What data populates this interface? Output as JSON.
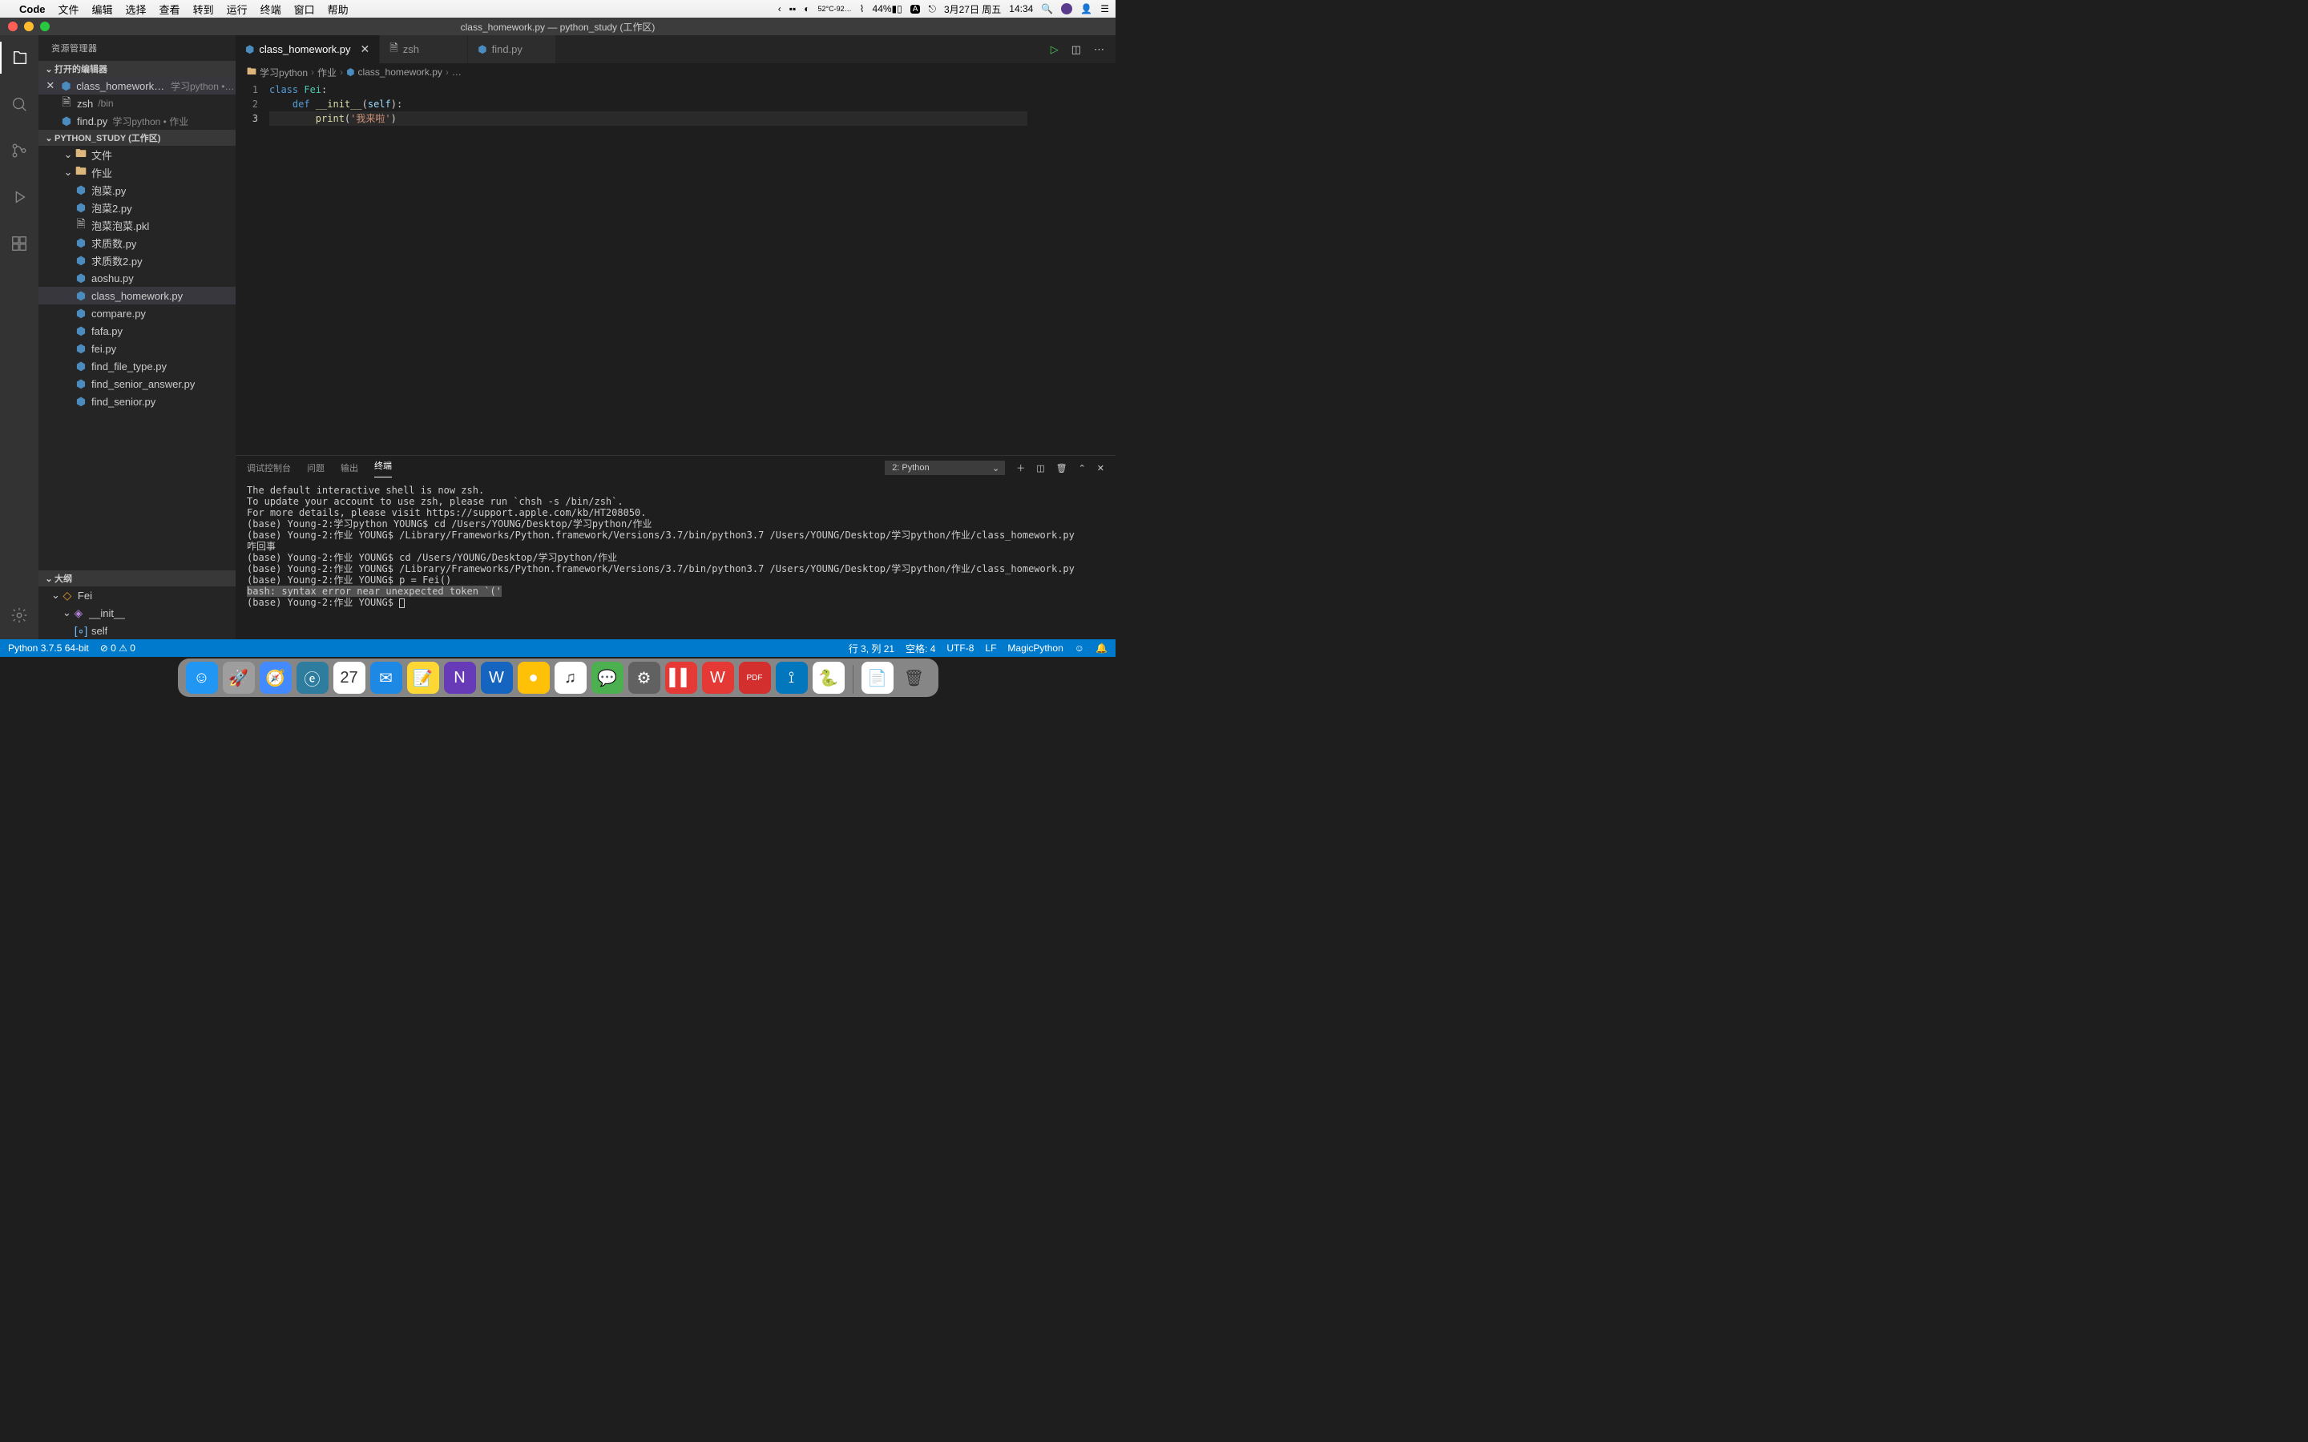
{
  "macos": {
    "appname": "Code",
    "menus": [
      "文件",
      "编辑",
      "选择",
      "查看",
      "转到",
      "运行",
      "终端",
      "窗口",
      "帮助"
    ],
    "temp": "52°C",
    "temp2": "-92…",
    "battery": "44%",
    "date": "3月27日 周五",
    "time": "14:34"
  },
  "window": {
    "title": "class_homework.py — python_study (工作区)"
  },
  "sidebar": {
    "title": "资源管理器",
    "openEditors": {
      "header": "打开的编辑器",
      "items": [
        {
          "name": "class_homework.py",
          "path": "学习python • …",
          "icon": "py",
          "active": true,
          "showClose": true
        },
        {
          "name": "zsh",
          "path": "/bin",
          "icon": "file",
          "active": false,
          "showClose": false
        },
        {
          "name": "find.py",
          "path": "学习python • 作业",
          "icon": "py",
          "active": false,
          "showClose": false
        }
      ]
    },
    "workspace": {
      "header": "PYTHON_STUDY (工作区)",
      "tree": [
        {
          "type": "folder",
          "name": "文件",
          "depth": 1,
          "expanded": true,
          "chev": "⌄"
        },
        {
          "type": "folder",
          "name": "作业",
          "depth": 1,
          "expanded": true,
          "chev": "⌄"
        },
        {
          "type": "py",
          "name": "泡菜.py",
          "depth": 2
        },
        {
          "type": "py",
          "name": "泡菜2.py",
          "depth": 2
        },
        {
          "type": "file",
          "name": "泡菜泡菜.pkl",
          "depth": 2
        },
        {
          "type": "py",
          "name": "求质数.py",
          "depth": 2
        },
        {
          "type": "py",
          "name": "求质数2.py",
          "depth": 2
        },
        {
          "type": "py",
          "name": "aoshu.py",
          "depth": 2
        },
        {
          "type": "py",
          "name": "class_homework.py",
          "depth": 2,
          "selected": true
        },
        {
          "type": "py",
          "name": "compare.py",
          "depth": 2
        },
        {
          "type": "py",
          "name": "fafa.py",
          "depth": 2
        },
        {
          "type": "py",
          "name": "fei.py",
          "depth": 2
        },
        {
          "type": "py",
          "name": "find_file_type.py",
          "depth": 2
        },
        {
          "type": "py",
          "name": "find_senior_answer.py",
          "depth": 2
        },
        {
          "type": "py",
          "name": "find_senior.py",
          "depth": 2
        }
      ]
    },
    "outline": {
      "header": "大纲",
      "items": [
        {
          "kind": "class",
          "name": "Fei",
          "depth": 0
        },
        {
          "kind": "method",
          "name": "__init__",
          "depth": 1
        },
        {
          "kind": "var",
          "name": "self",
          "depth": 2
        }
      ]
    }
  },
  "tabs": [
    {
      "name": "class_homework.py",
      "icon": "py",
      "active": true,
      "close": true
    },
    {
      "name": "zsh",
      "icon": "file",
      "active": false,
      "close": false
    },
    {
      "name": "find.py",
      "icon": "py",
      "active": false,
      "close": false
    }
  ],
  "breadcrumbs": [
    "学习python",
    "作业",
    "class_homework.py",
    "…"
  ],
  "code": {
    "lines": [
      "1",
      "2",
      "3"
    ],
    "currentLine": 3
  },
  "panel": {
    "tabs": [
      "调试控制台",
      "问题",
      "输出",
      "终端"
    ],
    "activeTab": "终端",
    "selector": "2: Python",
    "terminal_lines": [
      "The default interactive shell is now zsh.",
      "To update your account to use zsh, please run `chsh -s /bin/zsh`.",
      "For more details, please visit https://support.apple.com/kb/HT208050.",
      "(base) Young-2:学习python YOUNG$ cd /Users/YOUNG/Desktop/学习python/作业",
      "(base) Young-2:作业 YOUNG$ /Library/Frameworks/Python.framework/Versions/3.7/bin/python3.7 /Users/YOUNG/Desktop/学习python/作业/class_homework.py",
      "咋回事",
      "(base) Young-2:作业 YOUNG$ cd /Users/YOUNG/Desktop/学习python/作业",
      "(base) Young-2:作业 YOUNG$ /Library/Frameworks/Python.framework/Versions/3.7/bin/python3.7 /Users/YOUNG/Desktop/学习python/作业/class_homework.py",
      "(base) Young-2:作业 YOUNG$ p = Fei()"
    ],
    "terminal_error": "bash: syntax error near unexpected token `('",
    "terminal_prompt": "(base) Young-2:作业 YOUNG$ "
  },
  "statusbar": {
    "python": "Python 3.7.5 64-bit",
    "errors": "0",
    "warnings": "0",
    "lineCol": "行 3, 列 21",
    "spaces": "空格: 4",
    "encoding": "UTF-8",
    "eol": "LF",
    "lang": "MagicPython"
  },
  "dock": {
    "items": [
      {
        "name": "finder",
        "bg": "#2196f3",
        "glyph": "☺"
      },
      {
        "name": "launchpad",
        "bg": "#9e9e9e",
        "glyph": "🚀"
      },
      {
        "name": "safari",
        "bg": "#448aff",
        "glyph": "🧭"
      },
      {
        "name": "edge",
        "bg": "#2e7d9e",
        "glyph": "ⓔ"
      },
      {
        "name": "calendar",
        "bg": "#ffffff",
        "glyph": "27"
      },
      {
        "name": "outlook",
        "bg": "#1e88e5",
        "glyph": "✉"
      },
      {
        "name": "notes",
        "bg": "#fdd835",
        "glyph": "📝"
      },
      {
        "name": "onenote",
        "bg": "#673ab7",
        "glyph": "N"
      },
      {
        "name": "word",
        "bg": "#1565c0",
        "glyph": "W"
      },
      {
        "name": "app1",
        "bg": "#ffc107",
        "glyph": "●"
      },
      {
        "name": "music",
        "bg": "#ffffff",
        "glyph": "♫"
      },
      {
        "name": "wechat",
        "bg": "#4caf50",
        "glyph": "💬"
      },
      {
        "name": "settings",
        "bg": "#616161",
        "glyph": "⚙"
      },
      {
        "name": "parallels",
        "bg": "#e53935",
        "glyph": "▌▌"
      },
      {
        "name": "wps",
        "bg": "#e53935",
        "glyph": "W"
      },
      {
        "name": "pdf",
        "bg": "#d32f2f",
        "glyph": "PDF"
      },
      {
        "name": "vscode",
        "bg": "#0277bd",
        "glyph": "⟟"
      },
      {
        "name": "python",
        "bg": "#fff",
        "glyph": "🐍"
      },
      {
        "name": "textedit",
        "bg": "#fff",
        "glyph": "📄"
      },
      {
        "name": "trash",
        "bg": "transparent",
        "glyph": "🗑"
      }
    ]
  }
}
